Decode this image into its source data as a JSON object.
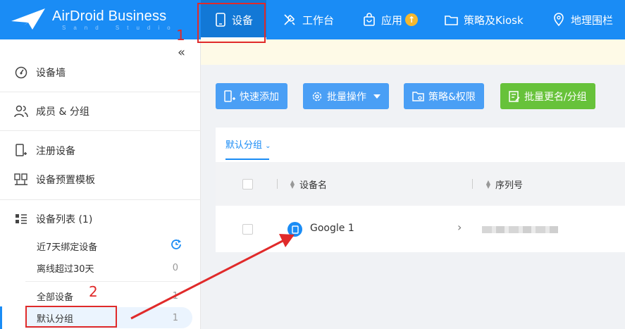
{
  "brand": {
    "name": "AirDroid Business",
    "sub": "Sand Studio"
  },
  "nav": [
    {
      "label": "设备",
      "icon": "phone-icon",
      "active": true
    },
    {
      "label": "工作台",
      "icon": "tools-icon"
    },
    {
      "label": "应用",
      "icon": "bag-icon",
      "badge": "up-arrow-badge"
    },
    {
      "label": "策略及Kiosk",
      "icon": "folder-icon"
    },
    {
      "label": "地理围栏",
      "icon": "map-pin-icon"
    }
  ],
  "sidebar": {
    "items": [
      {
        "label": "设备墙",
        "icon": "dashboard-icon"
      },
      {
        "label": "成员 & 分组",
        "icon": "users-icon"
      },
      {
        "label": "注册设备",
        "icon": "register-device-icon"
      },
      {
        "label": "设备预置模板",
        "icon": "template-icon"
      },
      {
        "label": "设备列表 (1)",
        "icon": "list-icon"
      }
    ],
    "subitems": [
      {
        "label": "近7天绑定设备",
        "count": "",
        "icon": "history-icon"
      },
      {
        "label": "离线超过30天",
        "count": "0"
      },
      {
        "label": "全部设备",
        "count": "1"
      },
      {
        "label": "默认分组",
        "count": "1",
        "selected": true
      }
    ]
  },
  "toolbar": {
    "buttons": [
      {
        "label": "快速添加",
        "icon": "add-device-icon"
      },
      {
        "label": "批量操作",
        "icon": "gear-icon",
        "dropdown": true
      },
      {
        "label": "策略&权限",
        "icon": "policy-folder-icon"
      },
      {
        "label": "批量更名/分组",
        "icon": "rename-icon"
      }
    ]
  },
  "panel": {
    "group_tab": "默认分组",
    "columns": [
      "设备名",
      "序列号"
    ],
    "rows": [
      {
        "name": "Google 1",
        "serial": ""
      }
    ]
  },
  "annotations": {
    "step1": "1",
    "step2": "2",
    "color": "#e02a2a"
  },
  "colors": {
    "primary": "#1a8cf5",
    "green": "#67c23a"
  }
}
